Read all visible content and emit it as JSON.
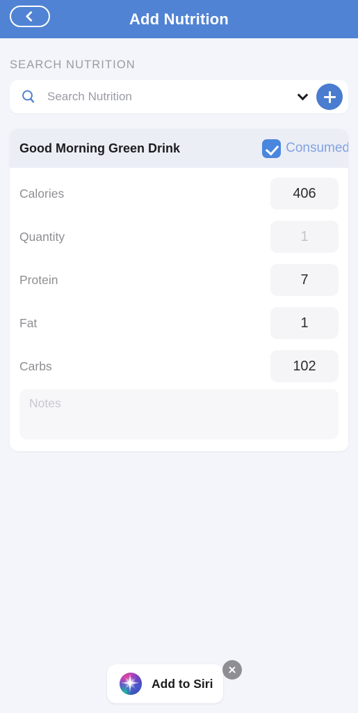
{
  "header": {
    "title": "Add Nutrition",
    "back_icon": "chevron-left-icon"
  },
  "search": {
    "section_label": "SEARCH NUTRITION",
    "placeholder": "Search Nutrition",
    "value": "",
    "search_icon": "search-icon",
    "expand_icon": "chevron-down-icon",
    "add_icon": "plus-icon"
  },
  "card": {
    "title": "Good Morning Green Drink",
    "consumed_label": "Consumed",
    "consumed_checked": true,
    "check_icon": "checkmark-icon",
    "fields": [
      {
        "label": "Calories",
        "value": "406",
        "muted": false
      },
      {
        "label": "Quantity",
        "value": "1",
        "muted": true
      },
      {
        "label": "Protein",
        "value": "7",
        "muted": false
      },
      {
        "label": "Fat",
        "value": "1",
        "muted": false
      },
      {
        "label": "Carbs",
        "value": "102",
        "muted": false
      }
    ],
    "notes": {
      "placeholder": "Notes",
      "value": ""
    }
  },
  "siri": {
    "label": "Add to Siri",
    "orb_icon": "siri-orb-icon",
    "close_icon": "close-icon"
  },
  "colors": {
    "navbar": "#5183d4",
    "accent": "#4a7cd0",
    "page_background": "#f4f5fa",
    "card_header": "#eceef6",
    "consumed_text": "#81a2e0",
    "value_pill": "#f5f5f7"
  }
}
